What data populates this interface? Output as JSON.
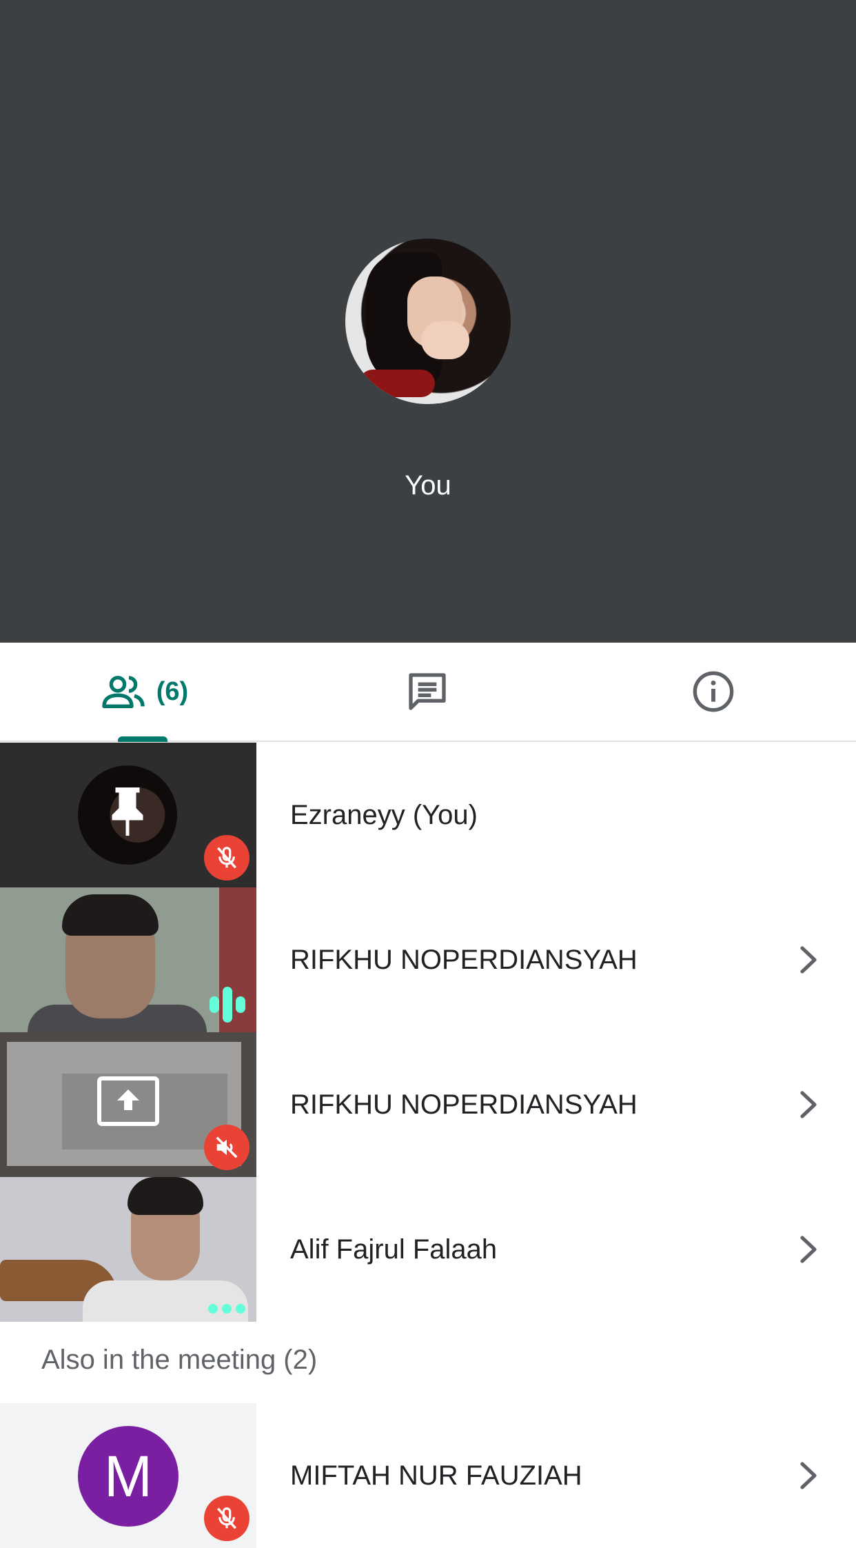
{
  "self_view": {
    "label": "You",
    "avatar": "self-avatar-photo"
  },
  "tabs": {
    "people": {
      "icon": "people-icon",
      "count": "(6)",
      "selected": true
    },
    "chat": {
      "icon": "chat-icon"
    },
    "info": {
      "icon": "info-icon"
    },
    "accent_color": "#00796b"
  },
  "participants": [
    {
      "name": "Ezraneyy (You)",
      "thumb": "avatar-photo",
      "overlay_icon": "pin-icon",
      "status_icon": "mic-off-icon",
      "has_chevron": false
    },
    {
      "name": "RIFKHU NOPERDIANSYAH",
      "thumb": "camera-video",
      "status_icon": "audio-level-icon",
      "has_chevron": true
    },
    {
      "name": "RIFKHU NOPERDIANSYAH",
      "thumb": "screen-share",
      "overlay_icon": "present-screen-icon",
      "status_icon": "volume-off-icon",
      "has_chevron": true
    },
    {
      "name": "Alif Fajrul Falaah",
      "thumb": "camera-video",
      "status_icon": "audio-dots-icon",
      "has_chevron": true
    }
  ],
  "also_in_meeting": {
    "header": "Also in the meeting (2)",
    "items": [
      {
        "name": "MIFTAH NUR FAUZIAH",
        "avatar_letter": "M",
        "avatar_color": "#7b1fa2",
        "status_icon": "mic-off-icon",
        "has_chevron": true
      }
    ]
  },
  "colors": {
    "self_view_bg": "#3c4043",
    "muted_red": "#ea4335",
    "audio_green": "#64ffda"
  }
}
